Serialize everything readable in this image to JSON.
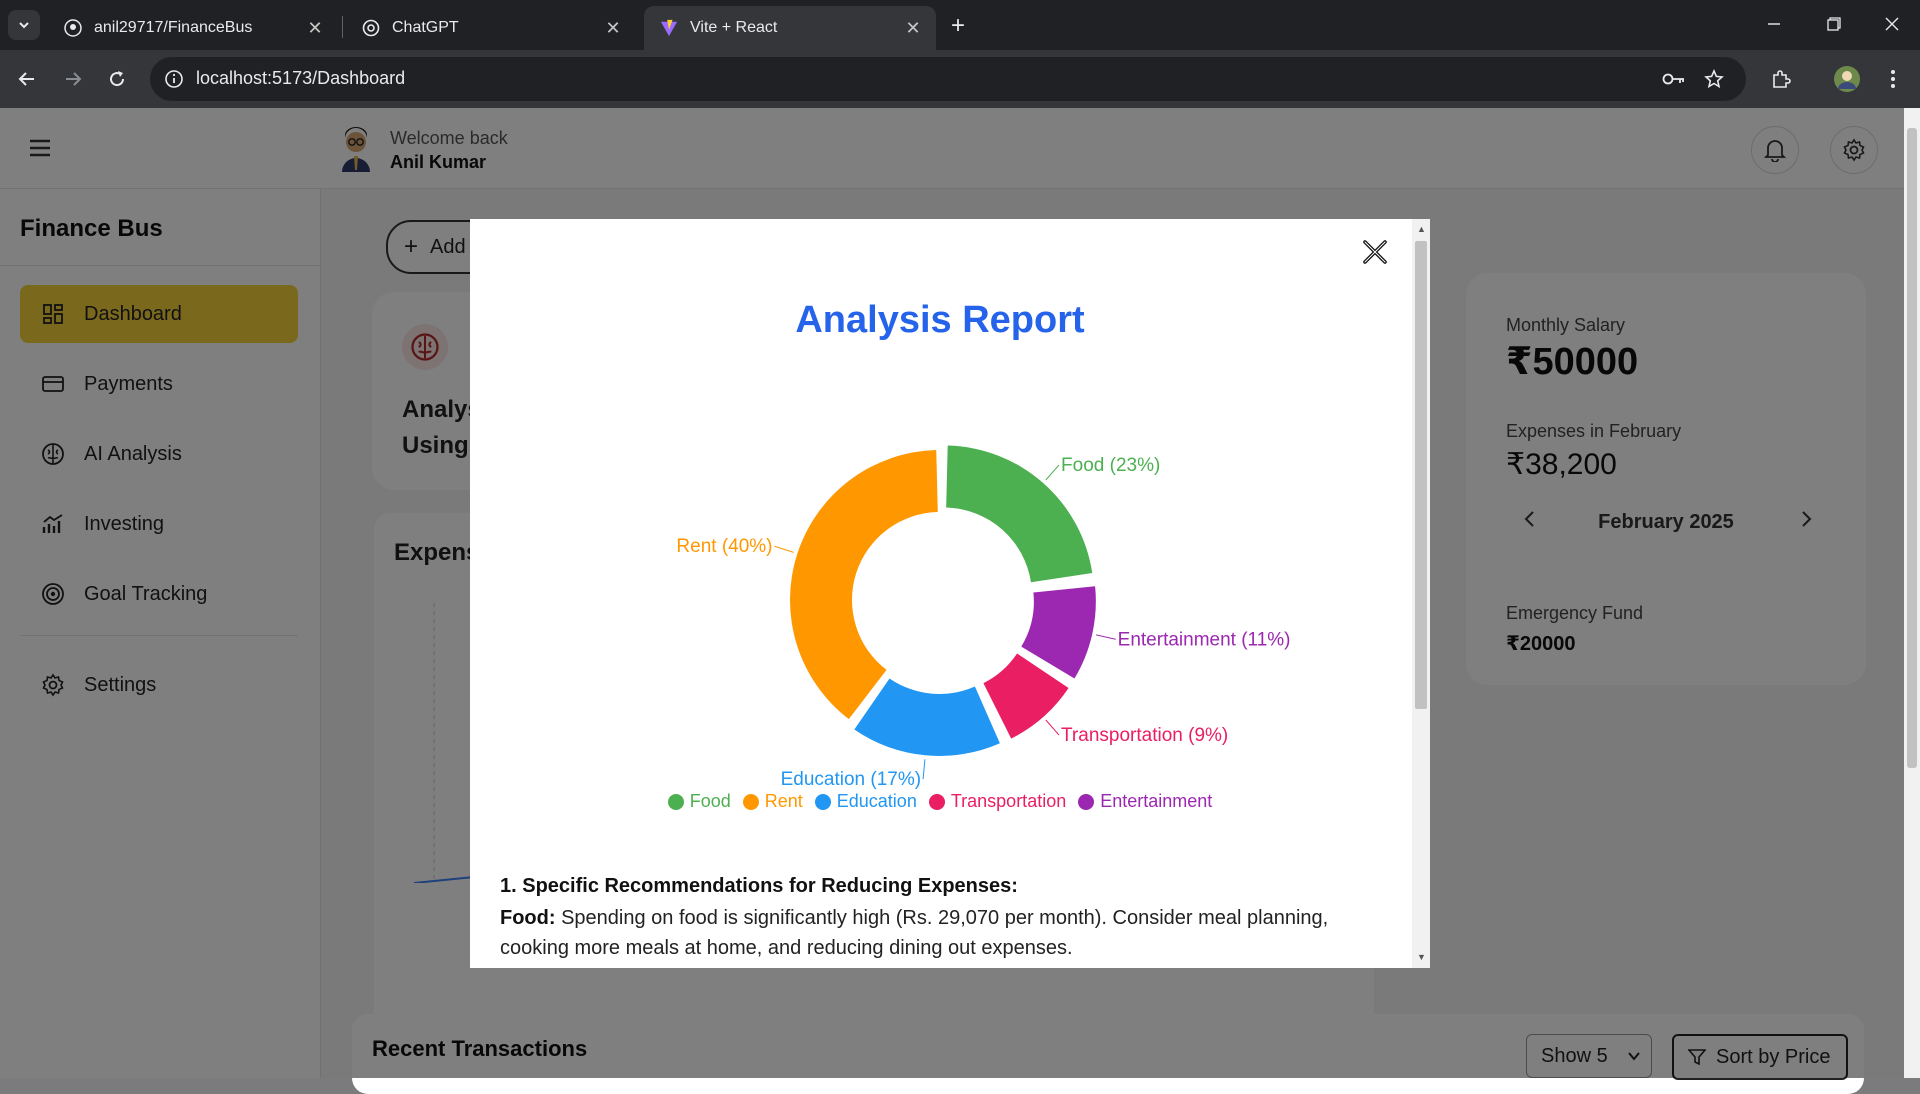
{
  "browser": {
    "tabs": [
      {
        "title": "anil29717/FinanceBus",
        "icon": "github-icon"
      },
      {
        "title": "ChatGPT",
        "icon": "chatgpt-icon"
      },
      {
        "title": "Vite + React",
        "icon": "vite-icon",
        "active": true
      }
    ],
    "url": "localhost:5173/Dashboard"
  },
  "header": {
    "welcome": "Welcome back",
    "user_name": "Anil Kumar"
  },
  "sidebar": {
    "brand": "Finance Bus",
    "items": [
      {
        "label": "Dashboard",
        "icon": "dashboard-icon",
        "active": true
      },
      {
        "label": "Payments",
        "icon": "card-icon"
      },
      {
        "label": "AI Analysis",
        "icon": "brain-icon"
      },
      {
        "label": "Investing",
        "icon": "chart-icon"
      },
      {
        "label": "Goal Tracking",
        "icon": "target-icon"
      },
      {
        "label": "Settings",
        "icon": "gear-icon"
      }
    ]
  },
  "main": {
    "add_button": "Add",
    "ai_card_title_line1": "Analys",
    "ai_card_title_line2": "Using",
    "expense_card_title": "Expens",
    "recent_transactions": "Recent Transactions",
    "show_select": "Show 5",
    "sort_button": "Sort by Price"
  },
  "summary": {
    "salary_label": "Monthly Salary",
    "salary_value": "₹50000",
    "expenses_label": "Expenses in February",
    "expenses_value": "₹38,200",
    "month": "February 2025",
    "emergency_label": "Emergency Fund",
    "emergency_value": "₹20000"
  },
  "modal": {
    "title": "Analysis Report",
    "rec_heading": "1. Specific Recommendations for Reducing Expenses:",
    "rec_label": "Food:",
    "rec_text": "Spending on food is significantly high (Rs. 29,070 per month). Consider meal planning, cooking more meals at home, and reducing dining out expenses."
  },
  "chart_data": {
    "type": "pie",
    "title": "Analysis Report",
    "categories": [
      "Food",
      "Rent",
      "Education",
      "Transportation",
      "Entertainment"
    ],
    "values": [
      23,
      40,
      17,
      9,
      11
    ],
    "labels": [
      "Food (23%)",
      "Rent (40%)",
      "Education (17%)",
      "Transportation (9%)",
      "Entertainment (11%)"
    ],
    "colors": [
      "#4caf50",
      "#ff9800",
      "#2196f3",
      "#e91e63",
      "#9c27b0"
    ],
    "legend": "bottom",
    "legend_order": [
      "Food",
      "Rent",
      "Education",
      "Transportation",
      "Entertainment"
    ]
  }
}
